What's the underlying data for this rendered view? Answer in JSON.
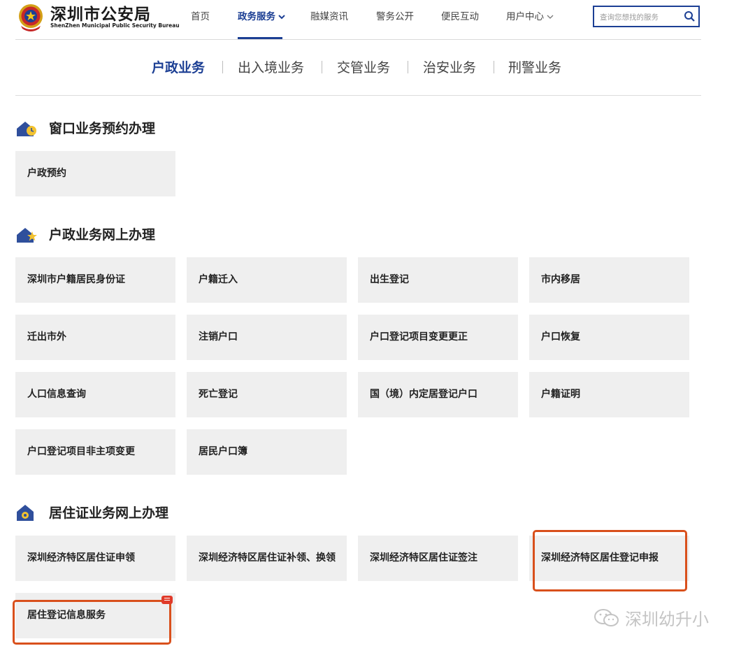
{
  "header": {
    "brand_cn": "深圳市公安局",
    "brand_en": "ShenZhen Municipal Public Security Bureau",
    "nav": [
      "首页",
      "政务服务",
      "融媒资讯",
      "警务公开",
      "便民互动",
      "用户中心"
    ],
    "search_placeholder": "查询您想找的服务"
  },
  "tabs": [
    "户政业务",
    "出入境业务",
    "交管业务",
    "治安业务",
    "刑警业务"
  ],
  "sections": [
    {
      "title": "窗口业务预约办理",
      "items": [
        "户政预约"
      ]
    },
    {
      "title": "户政业务网上办理",
      "items": [
        "深圳市户籍居民身份证",
        "户籍迁入",
        "出生登记",
        "市内移居",
        "迁出市外",
        "注销户口",
        "户口登记项目变更更正",
        "户口恢复",
        "人口信息查询",
        "死亡登记",
        "国（境）内定居登记户口",
        "户籍证明",
        "户口登记项目非主项变更",
        "居民户口簿"
      ]
    },
    {
      "title": "居住证业务网上办理",
      "items": [
        "深圳经济特区居住证申领",
        "深圳经济特区居住证补领、换领",
        "深圳经济特区居住证签注",
        "深圳经济特区居住登记申报",
        "居住登记信息服务"
      ]
    }
  ],
  "watermark": "深圳幼升小",
  "colors": {
    "brand": "#1c3f94",
    "highlight": "#d9501c",
    "card_bg": "#efefef"
  }
}
